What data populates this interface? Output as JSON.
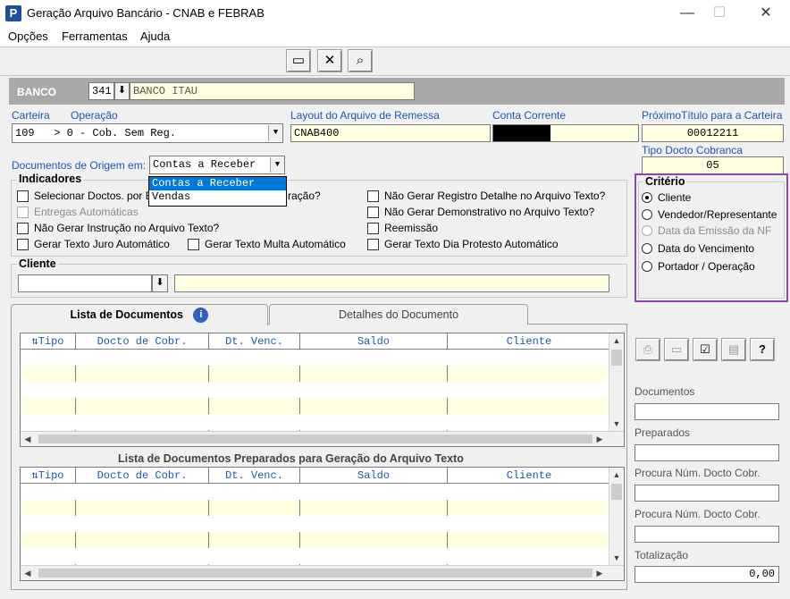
{
  "window": {
    "app_icon": "P",
    "title": "Geração Arquivo Bancário - CNAB e FEBRAB",
    "minimize": "—",
    "maximize": "☐",
    "close": "✕"
  },
  "menu": {
    "items": [
      {
        "label": "Opções"
      },
      {
        "label": "Ferramentas"
      },
      {
        "label": "Ajuda"
      }
    ]
  },
  "toolbar": {
    "buttons": [
      {
        "icon": "window-icon",
        "glyph": "▭"
      },
      {
        "icon": "close-x-icon",
        "glyph": "✕"
      },
      {
        "icon": "binoculars-icon",
        "glyph": "⌕"
      }
    ]
  },
  "banco": {
    "label": "BANCO",
    "code": "341",
    "name": "BANCO ITAU"
  },
  "carteira": {
    "label": "Carteira",
    "operacao_label": "Operação",
    "value": "109   > 0 - Cob. Sem Reg."
  },
  "layout": {
    "label": "Layout do Arquivo de Remessa",
    "value": "CNAB400"
  },
  "conta_corrente": {
    "label": "Conta Corrente",
    "value": ""
  },
  "proximo_titulo": {
    "label": "PróximoTítulo para a Carteira",
    "value": "00012211"
  },
  "tipo_docto": {
    "label": "Tipo Docto Cobranca",
    "value": "05"
  },
  "documentos_origem": {
    "label": "Documentos de Origem em:",
    "selected": "Contas a Receber",
    "options": [
      "Contas a Receber",
      "Vendas"
    ]
  },
  "indicadores": {
    "title": "Indicadores",
    "items": [
      {
        "label": "Selecionar Doctos. por E",
        "enabled": true
      },
      {
        "label": "Entregas Automáticas",
        "enabled": false
      },
      {
        "label": "Não Gerar Instrução no Arquivo Texto?",
        "enabled": true
      },
      {
        "label": "Gerar Texto Juro Automático",
        "enabled": true
      },
      {
        "label": "Gerar Texto Multa Automático",
        "enabled": true
      },
      {
        "label": "Não Gerar Registro Detalhe no Arquivo Texto?",
        "enabled": true
      },
      {
        "label": "Não Gerar Demonstrativo no Arquivo Texto?",
        "enabled": true
      },
      {
        "label": "Reemissão",
        "enabled": true
      },
      {
        "label": "Gerar Texto Dia Protesto Automático",
        "enabled": true
      }
    ],
    "hidden_fragment": "ração?"
  },
  "criterio": {
    "title": "Critério",
    "options": [
      {
        "label": "Cliente",
        "selected": true,
        "enabled": true
      },
      {
        "label": "Vendedor/Representante",
        "selected": false,
        "enabled": true
      },
      {
        "label": "Data da Emissão da NF",
        "selected": false,
        "enabled": false
      },
      {
        "label": "Data do Vencimento",
        "selected": false,
        "enabled": true
      },
      {
        "label": "Portador / Operação",
        "selected": false,
        "enabled": true
      }
    ]
  },
  "cliente": {
    "title": "Cliente",
    "code": "",
    "name": ""
  },
  "tabs": [
    {
      "label": "Lista de Documentos",
      "active": true
    },
    {
      "label": "Detalhes do Documento",
      "active": false
    }
  ],
  "grid": {
    "columns": [
      "Tipo",
      "Docto de Cobr.",
      "Dt. Venc.",
      "Saldo",
      "Cliente"
    ]
  },
  "prepared_section": {
    "title": "Lista de Documentos Preparados para Geração do Arquivo Texto"
  },
  "side_panel": {
    "buttons": [
      {
        "icon": "printer-icon",
        "glyph": "⎙"
      },
      {
        "icon": "blank-icon",
        "glyph": "▭"
      },
      {
        "icon": "checkbox-icon",
        "glyph": "☑"
      },
      {
        "icon": "document-icon",
        "glyph": "▤"
      },
      {
        "icon": "help-icon",
        "glyph": "?"
      }
    ],
    "documentos_label": "Documentos",
    "preparados_label": "Preparados",
    "procura1_label": "Procura Núm. Docto Cobr.",
    "procura2_label": "Procura Núm. Docto Cobr.",
    "totalizacao_label": "Totalização",
    "totalizacao_value": "0,00"
  },
  "colors": {
    "accent_blue": "#1a56b8",
    "field_yellow": "#ffffe1",
    "criterio_border": "#8e44ad",
    "selection": "#0078d7"
  }
}
